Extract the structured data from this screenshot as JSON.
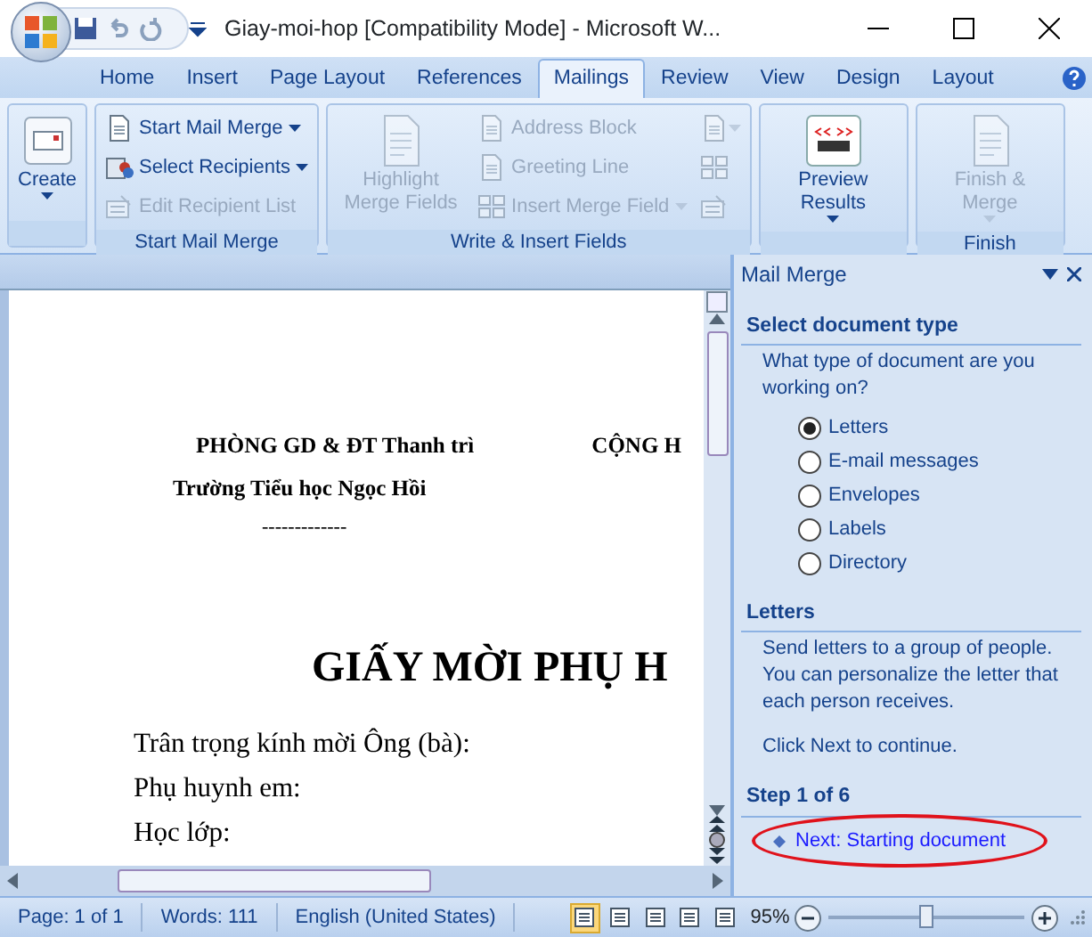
{
  "window": {
    "title": "Giay-moi-hop [Compatibility Mode] - Microsoft W..."
  },
  "tabs": [
    {
      "label": "Home",
      "selected": false
    },
    {
      "label": "Insert",
      "selected": false
    },
    {
      "label": "Page Layout",
      "selected": false
    },
    {
      "label": "References",
      "selected": false
    },
    {
      "label": "Mailings",
      "selected": true
    },
    {
      "label": "Review",
      "selected": false
    },
    {
      "label": "View",
      "selected": false
    },
    {
      "label": "Design",
      "selected": false
    },
    {
      "label": "Layout",
      "selected": false
    }
  ],
  "ribbon_groups": [
    {
      "buttons": [
        {
          "kind": "large",
          "label": "Create",
          "dropdown": true,
          "disabled": false
        }
      ]
    },
    {
      "label": "Start Mail Merge",
      "buttons": [
        {
          "kind": "small",
          "label": "Start Mail Merge",
          "dropdown": true,
          "disabled": false
        },
        {
          "kind": "small",
          "label": "Select Recipients",
          "dropdown": true,
          "disabled": false
        },
        {
          "kind": "small",
          "label": "Edit Recipient List",
          "dropdown": false,
          "disabled": true
        }
      ]
    },
    {
      "label": "Write & Insert Fields",
      "buttons": [
        {
          "kind": "large",
          "label": "Highlight Merge Fields",
          "dropdown": false,
          "disabled": true
        },
        {
          "kind": "small",
          "label": "Address Block",
          "dropdown": false,
          "disabled": true
        },
        {
          "kind": "small",
          "label": "Greeting Line",
          "dropdown": false,
          "disabled": true
        },
        {
          "kind": "small",
          "label": "Insert Merge Field",
          "dropdown": true,
          "disabled": true
        },
        {
          "kind": "icon",
          "dropdown": true,
          "disabled": true
        },
        {
          "kind": "icon",
          "dropdown": false,
          "disabled": true
        },
        {
          "kind": "icon",
          "dropdown": false,
          "disabled": true
        }
      ]
    },
    {
      "buttons": [
        {
          "kind": "large",
          "label": "Preview Results",
          "dropdown": true,
          "disabled": false
        }
      ]
    },
    {
      "label": "Finish",
      "buttons": [
        {
          "kind": "large",
          "label": "Finish & Merge",
          "dropdown": true,
          "disabled": true
        }
      ]
    }
  ],
  "document": {
    "lines": [
      {
        "kind": "org",
        "left": "PHÒNG GD & ĐT Thanh trì",
        "right": "CỘNG H"
      },
      {
        "kind": "school",
        "text": "Trường Tiểu học Ngọc Hồi"
      },
      {
        "kind": "rule",
        "text": "-------------"
      },
      {
        "kind": "title",
        "text": "GIẤY MỜI PHỤ H"
      },
      {
        "kind": "body",
        "text": "Trân trọng kính mời Ông (bà):"
      },
      {
        "kind": "body",
        "text": "Phụ huynh em:"
      },
      {
        "kind": "body",
        "text": "Học lớp:"
      }
    ]
  },
  "task_pane": {
    "title": "Mail Merge",
    "sections": [
      {
        "heading": "Select document type",
        "paragraphs": [
          "What type of document are you working on?"
        ],
        "options": [
          {
            "label": "Letters",
            "selected": true
          },
          {
            "label": "E-mail messages",
            "selected": false
          },
          {
            "label": "Envelopes",
            "selected": false
          },
          {
            "label": "Labels",
            "selected": false
          },
          {
            "label": "Directory",
            "selected": false
          }
        ]
      },
      {
        "heading": "Letters",
        "paragraphs": [
          "Send letters to a group of people. You can personalize the letter that each person receives.",
          "Click Next to continue."
        ]
      },
      {
        "heading": "Step 1 of 6",
        "link": "Next: Starting document"
      }
    ]
  },
  "status_bar": {
    "items": [
      "Page: 1 of 1",
      "Words: 111",
      "English (United States)"
    ],
    "views": [
      {
        "selected": true
      },
      {
        "selected": false
      },
      {
        "selected": false
      },
      {
        "selected": false
      },
      {
        "selected": false
      }
    ],
    "zoom": "95%",
    "zoom_slider": {
      "level": 0.5
    }
  }
}
